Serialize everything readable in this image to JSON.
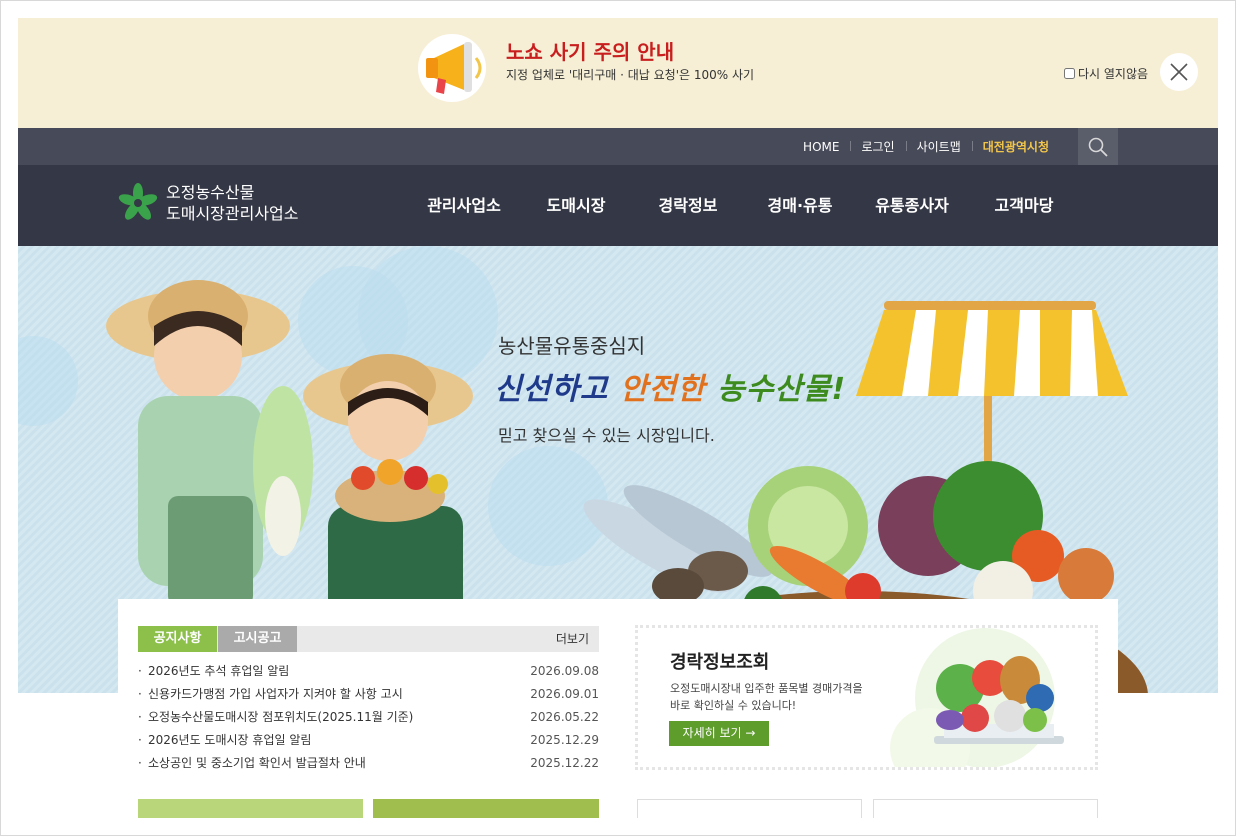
{
  "popup": {
    "title": "노쇼 사기 주의 안내",
    "subtitle": "지정 업체로 '대리구매 · 대납 요청'은 100% 사기",
    "dont_show_label": "다시 열지않음"
  },
  "util_nav": {
    "items": [
      {
        "label": "HOME"
      },
      {
        "label": "로그인"
      },
      {
        "label": "사이트맵"
      },
      {
        "label": "대전광역시청"
      }
    ]
  },
  "logo": {
    "line1": "오정농수산물",
    "line2": "도매시장관리사업소"
  },
  "main_nav": {
    "items": [
      {
        "label": "관리사업소"
      },
      {
        "label": "도매시장"
      },
      {
        "label": "경락정보"
      },
      {
        "label": "경매·유통"
      },
      {
        "label": "유통종사자"
      },
      {
        "label": "고객마당"
      }
    ]
  },
  "hero": {
    "eyebrow": "농산물유통중심지",
    "title_part1": "신선하고 ",
    "title_part2": "안전한 ",
    "title_part3": "농수산물!",
    "subtitle": "믿고 찾으실 수 있는 시장입니다."
  },
  "notice_board": {
    "tab_active": "공지사항",
    "tab_inactive": "고시공고",
    "more_label": "더보기",
    "items": [
      {
        "title": "2026년도 추석 휴업일 알림",
        "date": "2026.09.08"
      },
      {
        "title": "신용카드가맹점 가입 사업자가 지켜야 할 사항 고시",
        "date": "2026.09.01"
      },
      {
        "title": "오정농수산물도매시장 점포위치도(2025.11월 기준)",
        "date": "2026.05.22"
      },
      {
        "title": "2026년도 도매시장 휴업일 알림",
        "date": "2025.12.29"
      },
      {
        "title": "소상공인 및 중소기업 확인서 발급절차 안내",
        "date": "2025.12.22"
      }
    ]
  },
  "auction_box": {
    "title": "경락정보조회",
    "desc_line1": "오정도매시장내 입주한 품목별 경매가격을",
    "desc_line2": "바로 확인하실 수 있습니다!",
    "button_label": "자세히 보기  →"
  },
  "colors": {
    "popup_bg": "#f6efd6",
    "popup_title": "#c81e1e",
    "util_bg": "#474a58",
    "nav_bg": "#343745",
    "highlight": "#f2c64a",
    "tab_active": "#8cc04b",
    "tab_inactive": "#aaaaaa",
    "button_green": "#5e9c2c"
  }
}
